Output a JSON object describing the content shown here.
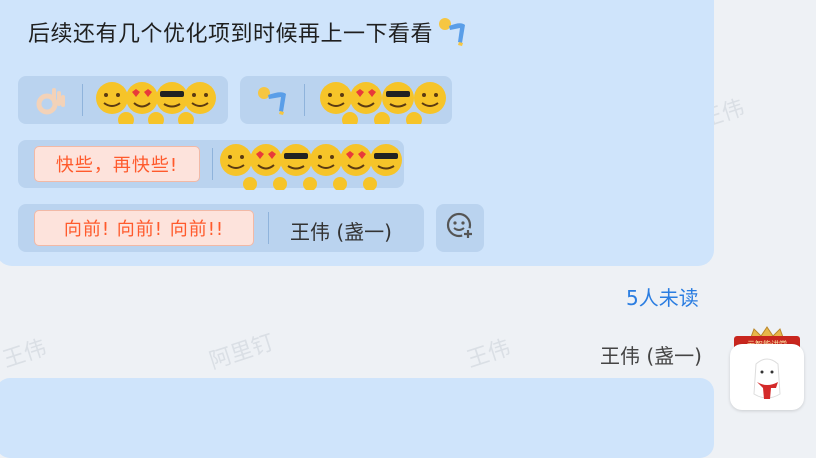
{
  "watermarks": [
    "王伟",
    "阿里钉",
    "王伟",
    "阿里钉",
    "王伟",
    "王伟"
  ],
  "message": {
    "text": "后续还有几个优化项到时候再上一下看看",
    "trailing_icon": "swinging-arm-emoji"
  },
  "reactions": [
    {
      "icon": "ok-hand-emoji",
      "emoji_group": "smiley-group-emoji"
    },
    {
      "icon": "swinging-arm-emoji",
      "emoji_group": "smiley-group-emoji"
    }
  ],
  "quick_reply_1": {
    "label": "快些，再快些!",
    "emoji_group": "smiley-group-emoji"
  },
  "quick_reply_2": {
    "label": "向前! 向前! 向前!!",
    "name": "王伟 (盏一)"
  },
  "add_reaction": {
    "icon": "add-emoji-icon"
  },
  "unread": "5人未读",
  "sender": "王伟 (盏一)",
  "avatar": {
    "badge": "云智能讲堂"
  },
  "colors": {
    "bubble": "#cfe4fb",
    "chip": "#bad3ef",
    "accent_orange": "#ff5a2c",
    "unread_blue": "#2a7de1",
    "background": "#eef1f5"
  }
}
